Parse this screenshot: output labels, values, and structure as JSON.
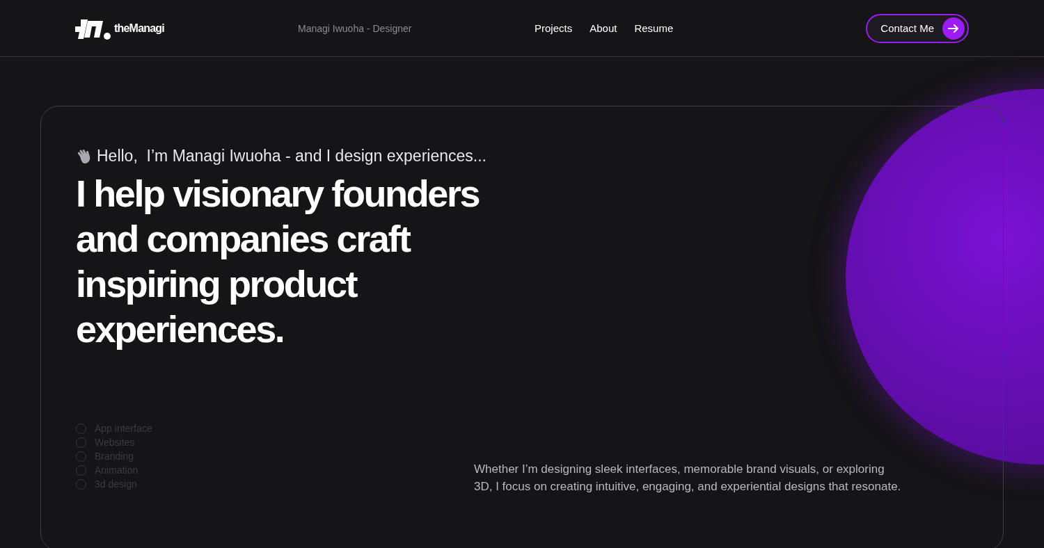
{
  "header": {
    "logo_text": "theManagi",
    "tagline": "Managi Iwuoha - Designer",
    "nav": [
      "Projects",
      "About",
      "Resume"
    ],
    "cta": "Contact Me"
  },
  "hero": {
    "greeting": "Hello,  I’m Managi Iwuoha - and I design experiences...",
    "headline": "I help visionary founders and companies craft inspiring product experiences.",
    "services": [
      "App interface",
      "Websites",
      "Branding",
      "Animation",
      "3d design"
    ],
    "description": "Whether I’m designing sleek interfaces, memorable brand visuals, or exploring 3D, I focus on creating intuitive, engaging, and experiential designs that resonate."
  }
}
